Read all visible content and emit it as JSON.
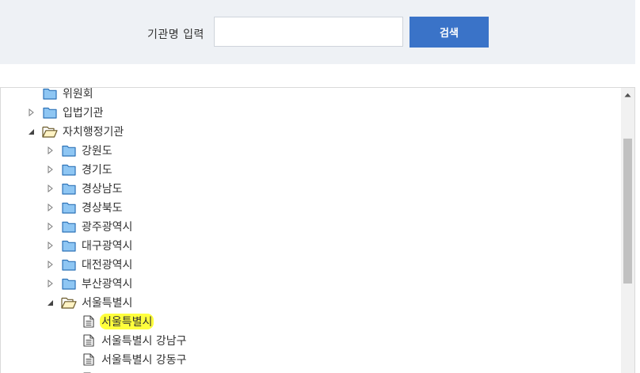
{
  "search": {
    "label": "기관명 입력",
    "input_value": "",
    "placeholder": "",
    "button_label": "검색"
  },
  "tree": {
    "nodes": [
      {
        "label": "위원회",
        "toggle": "none",
        "icon": "folder-closed",
        "selected": false
      },
      {
        "label": "입법기관",
        "toggle": "collapsed",
        "icon": "folder-closed",
        "selected": false
      },
      {
        "label": "자치행정기관",
        "toggle": "expanded",
        "icon": "folder-open",
        "selected": false
      },
      {
        "label": "강원도",
        "toggle": "collapsed",
        "icon": "folder-closed",
        "selected": false
      },
      {
        "label": "경기도",
        "toggle": "collapsed",
        "icon": "folder-closed",
        "selected": false
      },
      {
        "label": "경상남도",
        "toggle": "collapsed",
        "icon": "folder-closed",
        "selected": false
      },
      {
        "label": "경상북도",
        "toggle": "collapsed",
        "icon": "folder-closed",
        "selected": false
      },
      {
        "label": "광주광역시",
        "toggle": "collapsed",
        "icon": "folder-closed",
        "selected": false
      },
      {
        "label": "대구광역시",
        "toggle": "collapsed",
        "icon": "folder-closed",
        "selected": false
      },
      {
        "label": "대전광역시",
        "toggle": "collapsed",
        "icon": "folder-closed",
        "selected": false
      },
      {
        "label": "부산광역시",
        "toggle": "collapsed",
        "icon": "folder-closed",
        "selected": false
      },
      {
        "label": "서울특별시",
        "toggle": "expanded",
        "icon": "folder-open",
        "selected": false
      },
      {
        "label": "서울특별시",
        "toggle": "none",
        "icon": "document",
        "selected": true
      },
      {
        "label": "서울특별시 강남구",
        "toggle": "none",
        "icon": "document",
        "selected": false
      },
      {
        "label": "서울특별시 강동구",
        "toggle": "none",
        "icon": "document",
        "selected": false
      },
      {
        "label": "",
        "toggle": "none",
        "icon": "document",
        "selected": false
      }
    ]
  },
  "colors": {
    "search_bg": "#eef1f5",
    "button_bg": "#3a73c8",
    "folder_fill": "#8ec6f3",
    "folder_stroke": "#2e73b8",
    "highlight": "#ffff3d",
    "scroll_thumb": "#c1c1c1"
  }
}
